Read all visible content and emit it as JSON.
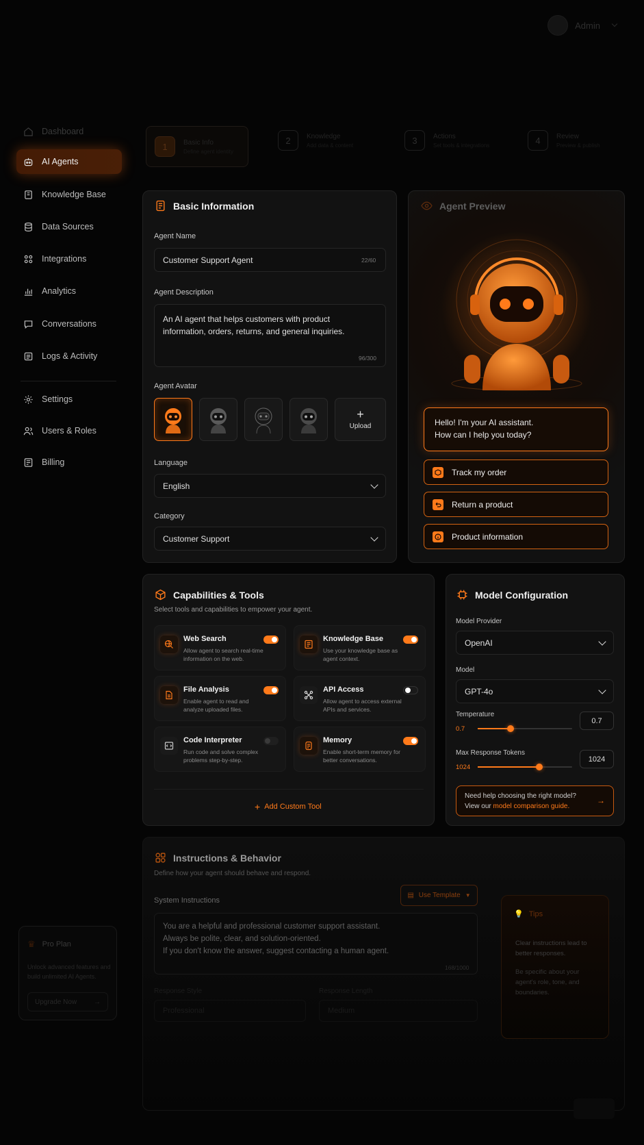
{
  "header": {
    "brand": "",
    "user_name": "Admin",
    "user_role": ""
  },
  "sidebar": {
    "items": [
      {
        "label": "Dashboard",
        "icon": "home-icon"
      },
      {
        "label": "AI Agents",
        "icon": "robot-icon"
      },
      {
        "label": "Knowledge Base",
        "icon": "book-icon"
      },
      {
        "label": "Data Sources",
        "icon": "database-icon"
      },
      {
        "label": "Integrations",
        "icon": "grid-icon"
      },
      {
        "label": "Analytics",
        "icon": "chart-icon"
      },
      {
        "label": "Conversations",
        "icon": "chat-icon"
      },
      {
        "label": "Logs & Activity",
        "icon": "log-icon"
      },
      {
        "label": "Settings",
        "icon": "gear-icon"
      },
      {
        "label": "Users & Roles",
        "icon": "users-icon"
      },
      {
        "label": "Billing",
        "icon": "billing-icon"
      }
    ],
    "pro": {
      "title": "Pro Plan",
      "desc": "Unlock advanced features and build unlimited AI Agents.",
      "button": "Upgrade Now"
    }
  },
  "steps": [
    {
      "num": "1",
      "title": "Basic Info",
      "sub": "Define agent identity"
    },
    {
      "num": "2",
      "title": "Knowledge",
      "sub": "Add data & content"
    },
    {
      "num": "3",
      "title": "Actions",
      "sub": "Set tools & integrations"
    },
    {
      "num": "4",
      "title": "Review",
      "sub": "Preview & publish"
    }
  ],
  "basic": {
    "title": "Basic Information",
    "name_label": "Agent Name",
    "name_value": "Customer Support Agent",
    "name_counter": "22/60",
    "desc_label": "Agent Description",
    "desc_value": "An AI agent that helps customers with product information, orders, returns, and general inquiries.",
    "desc_counter": "96/300",
    "avatar_label": "Agent Avatar",
    "upload_label": "Upload",
    "language_label": "Language",
    "language_value": "English",
    "category_label": "Category",
    "category_value": "Customer Support"
  },
  "preview": {
    "title": "Agent Preview",
    "greeting_1": "Hello! I'm your AI assistant.",
    "greeting_2": "How can I help you today?",
    "actions": [
      {
        "label": "Track my order",
        "icon": "box-icon"
      },
      {
        "label": "Return a product",
        "icon": "return-icon"
      },
      {
        "label": "Product information",
        "icon": "info-icon"
      }
    ]
  },
  "capabilities": {
    "title": "Capabilities & Tools",
    "subtitle": "Select tools and capabilities to empower your agent.",
    "items": [
      {
        "title": "Web Search",
        "desc": "Allow agent to search real-time information on the web.",
        "enabled": true
      },
      {
        "title": "Knowledge Base",
        "desc": "Use your knowledge base as agent context.",
        "enabled": true
      },
      {
        "title": "File Analysis",
        "desc": "Enable agent to read and analyze uploaded files.",
        "enabled": true
      },
      {
        "title": "API Access",
        "desc": "Allow agent to access external APIs and services.",
        "enabled": false
      },
      {
        "title": "Code Interpreter",
        "desc": "Run code and solve complex problems step-by-step.",
        "enabled": false
      },
      {
        "title": "Memory",
        "desc": "Enable short-term memory for better conversations.",
        "enabled": true
      }
    ],
    "add_custom": "Add Custom Tool"
  },
  "model": {
    "title": "Model Configuration",
    "provider_label": "Model Provider",
    "provider_value": "OpenAI",
    "model_label": "Model",
    "model_value": "GPT-4o",
    "temp_label": "Temperature",
    "temp_value": "0.7",
    "temp_fraction": 0.35,
    "tokens_label": "Max Response Tokens",
    "tokens_value": "1024",
    "tokens_fraction": 0.65,
    "help_line1": "Need help choosing the right model?",
    "help_line2_prefix": "View our ",
    "help_link": "model comparison guide."
  },
  "instructions": {
    "title": "Instructions & Behavior",
    "subtitle": "Define how your agent should behave and respond.",
    "system_label": "System Instructions",
    "template_button": "Use Template",
    "system_line1": "You are a helpful and professional customer support assistant.",
    "system_line2": "Always be polite, clear, and solution-oriented.",
    "system_line3": "If you don't know the answer, suggest contacting a human agent.",
    "system_counter": "168/1000",
    "style_label": "Response Style",
    "style_value": "Professional",
    "length_label": "Response Length",
    "length_value": "Medium"
  },
  "tips": {
    "title": "Tips",
    "tip1": "Clear instructions lead to better responses.",
    "tip2": "Be specific about your agent's role, tone, and boundaries."
  },
  "colors": {
    "accent": "#ff7a1a",
    "panel": "#121212",
    "background": "#050505"
  }
}
